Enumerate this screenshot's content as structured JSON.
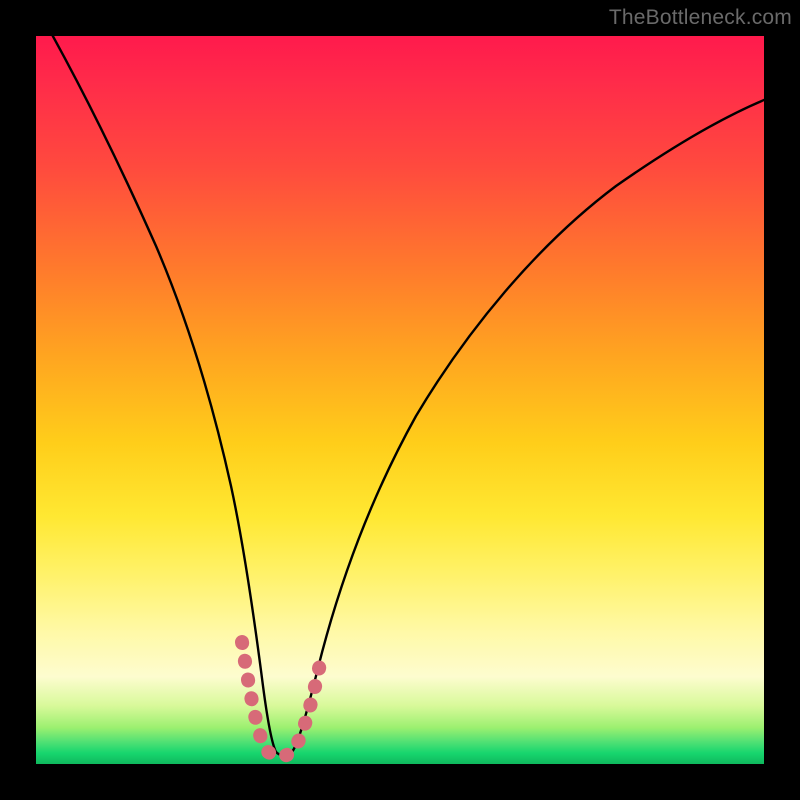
{
  "watermark": "TheBottleneck.com",
  "chart_data": {
    "type": "line",
    "title": "",
    "xlabel": "",
    "ylabel": "",
    "xlim": [
      0,
      100
    ],
    "ylim": [
      0,
      100
    ],
    "grid": false,
    "series": [
      {
        "name": "bottleneck-curve",
        "color": "#000000",
        "x": [
          0,
          4,
          8,
          12,
          16,
          20,
          23,
          25,
          27,
          28.5,
          30,
          32,
          34,
          36.5,
          40,
          45,
          52,
          60,
          70,
          80,
          90,
          100
        ],
        "y": [
          104,
          93,
          82,
          70,
          57,
          43,
          31,
          22,
          13,
          6,
          2,
          1.5,
          2,
          5,
          11,
          20,
          33,
          46,
          59,
          70,
          79,
          86
        ]
      },
      {
        "name": "highlight-band",
        "color": "#d76a78",
        "x": [
          26,
          27,
          28,
          29,
          30,
          31,
          32,
          33,
          34,
          35,
          36,
          37
        ],
        "y": [
          16,
          11,
          6,
          3,
          1.8,
          1.5,
          1.5,
          1.8,
          3,
          5,
          8,
          12
        ]
      }
    ],
    "background_gradient": {
      "stops": [
        {
          "pos": 0.0,
          "color": "#ff1a4c"
        },
        {
          "pos": 0.32,
          "color": "#ff7a2c"
        },
        {
          "pos": 0.56,
          "color": "#ffce1a"
        },
        {
          "pos": 0.82,
          "color": "#fff9a8"
        },
        {
          "pos": 0.95,
          "color": "#9cf070"
        },
        {
          "pos": 1.0,
          "color": "#0fb85d"
        }
      ]
    }
  }
}
